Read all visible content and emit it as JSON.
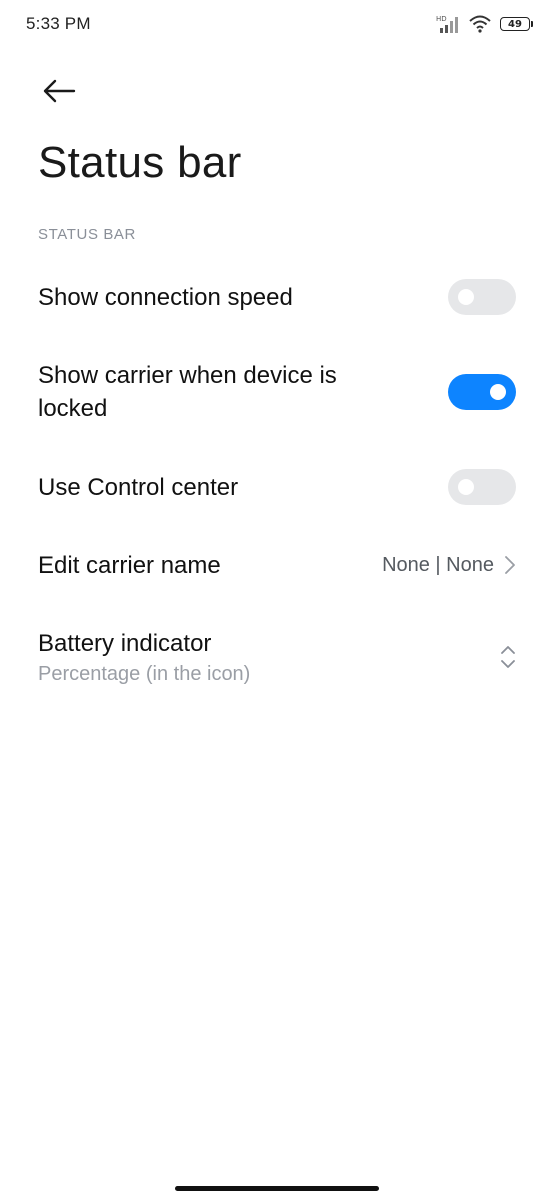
{
  "system": {
    "time": "5:33 PM",
    "network_badge": "HD",
    "battery_level": "49",
    "icons": [
      "signal-icon",
      "wifi-icon",
      "battery-icon"
    ]
  },
  "header": {
    "back_icon": "arrow-left-icon",
    "title": "Status bar"
  },
  "section": {
    "label": "STATUS BAR"
  },
  "settings": {
    "connection_speed": {
      "label": "Show connection speed",
      "enabled": false
    },
    "carrier_locked": {
      "label": "Show carrier when device is locked",
      "enabled": true
    },
    "control_center": {
      "label": "Use Control center",
      "enabled": false
    },
    "carrier_name": {
      "label": "Edit carrier name",
      "value": "None | None"
    },
    "battery_indicator": {
      "label": "Battery indicator",
      "value": "Percentage (in the icon)"
    }
  },
  "colors": {
    "accent": "#0d84ff",
    "toggle_off": "#e6e7e9",
    "secondary_text": "#9a9ea5",
    "section_header": "#8a8f98"
  }
}
